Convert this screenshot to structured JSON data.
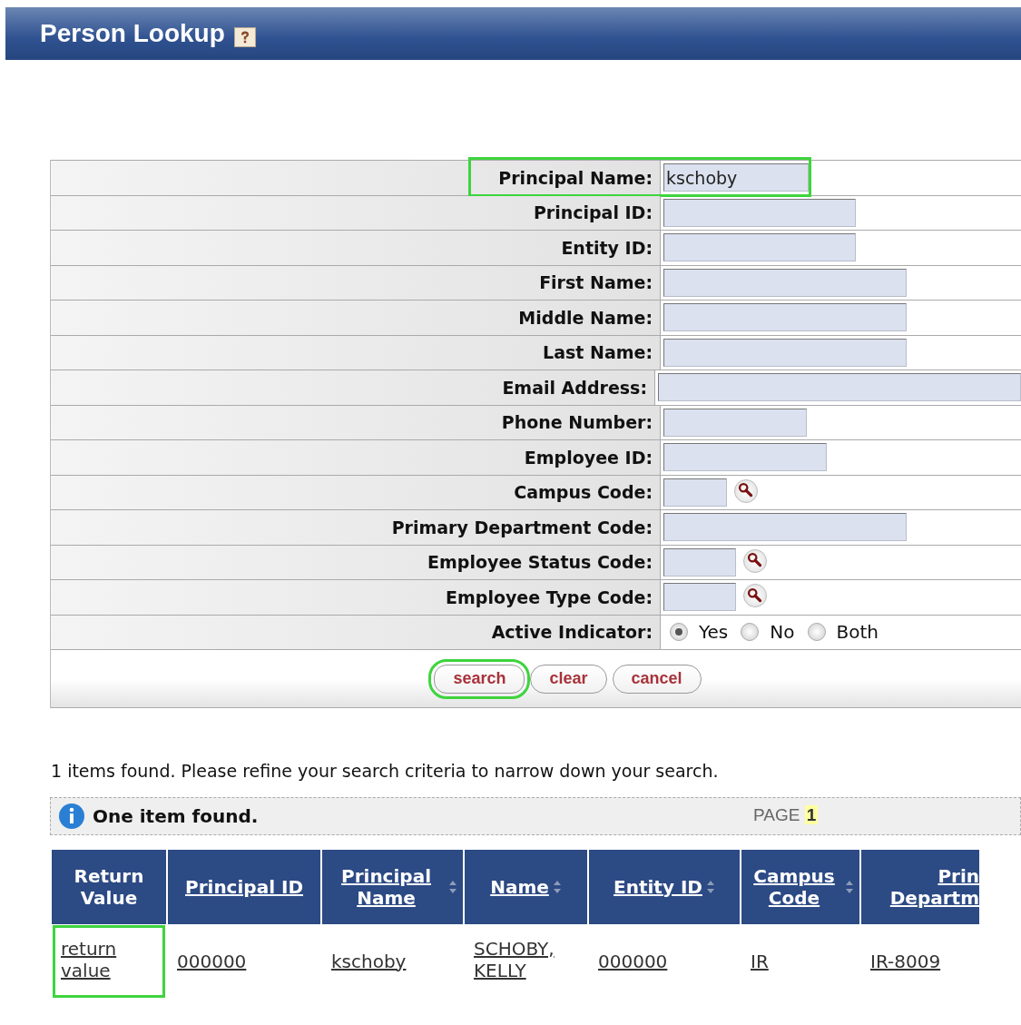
{
  "title": "Person Lookup",
  "fields": [
    {
      "kind": "text",
      "label": "Principal Name:",
      "value": "kschoby",
      "highlighted": true
    },
    {
      "kind": "text",
      "label": "Principal ID:",
      "highlighted": false
    },
    {
      "kind": "text",
      "label": "Entity ID:",
      "highlighted": false
    },
    {
      "kind": "text",
      "label": "First Name:",
      "highlighted": false
    },
    {
      "kind": "text",
      "label": "Middle Name:",
      "highlighted": false
    },
    {
      "kind": "text",
      "label": "Last Name:",
      "highlighted": false
    },
    {
      "kind": "text",
      "label": "Email Address:",
      "highlighted": false
    },
    {
      "kind": "text",
      "label": "Phone Number:",
      "highlighted": false
    },
    {
      "kind": "text",
      "label": "Employee ID:",
      "highlighted": false
    },
    {
      "kind": "lookup",
      "label": "Campus Code:",
      "highlighted": false
    },
    {
      "kind": "text",
      "label": "Primary Department Code:",
      "highlighted": false
    },
    {
      "kind": "lookup",
      "label": "Employee Status Code:",
      "highlighted": false
    },
    {
      "kind": "lookup",
      "label": "Employee Type Code:",
      "highlighted": false
    },
    {
      "kind": "radio",
      "label": "Active Indicator:",
      "highlighted": false,
      "options": [
        {
          "label": "Yes",
          "selected": true
        },
        {
          "label": "No",
          "selected": false
        },
        {
          "label": "Both",
          "selected": false
        }
      ]
    }
  ],
  "buttons": [
    {
      "label": "search",
      "highlighted": true
    },
    {
      "label": "clear",
      "highlighted": false
    },
    {
      "label": "cancel",
      "highlighted": false
    }
  ],
  "message": "1 items found. Please refine your search criteria to narrow down your search.",
  "info_bar": {
    "text": "One item found.",
    "page_label": "PAGE",
    "page": "1"
  },
  "table": {
    "columns": [
      {
        "label": "Return Value",
        "link": false,
        "sortable": false
      },
      {
        "label": "Principal ID",
        "link": true,
        "sortable": false
      },
      {
        "label": "Principal Name",
        "link": true,
        "sortable": true
      },
      {
        "label": "Name",
        "link": true,
        "sortable": true
      },
      {
        "label": "Entity ID",
        "link": true,
        "sortable": true
      },
      {
        "label": "Campus Code",
        "link": true,
        "sortable": true
      },
      {
        "label": "Prin Departm",
        "link": true,
        "sortable": false
      }
    ],
    "rows": [
      {
        "cells": [
          "return value",
          "000000",
          "kschoby",
          "SCHOBY, KELLY",
          "000000",
          "IR",
          "IR-8009"
        ],
        "highlighted": true
      }
    ]
  }
}
